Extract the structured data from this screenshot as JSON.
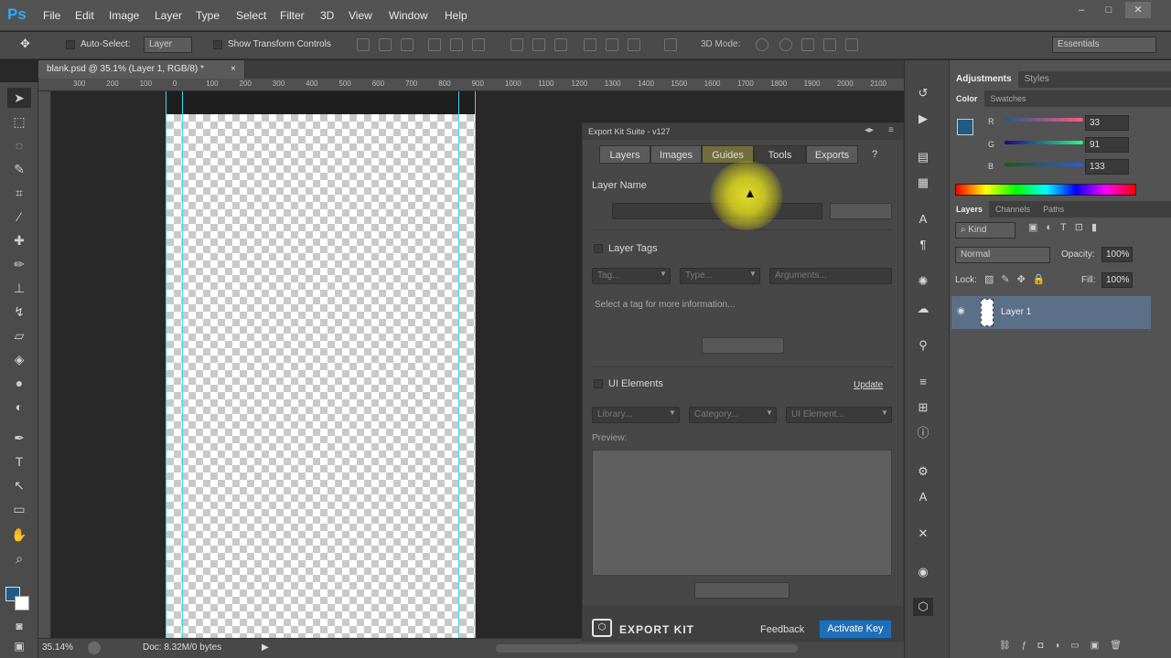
{
  "app": {
    "logo": "Ps"
  },
  "menu": [
    "File",
    "Edit",
    "Image",
    "Layer",
    "Type",
    "Select",
    "Filter",
    "3D",
    "View",
    "Window",
    "Help"
  ],
  "window_controls": {
    "min": "–",
    "max": "□",
    "close": "✕"
  },
  "options_bar": {
    "auto_select_label": "Auto-Select:",
    "auto_select_value": "Layer",
    "show_transform_label": "Show Transform Controls",
    "mode_3d_label": "3D Mode:",
    "workspace": "Essentials"
  },
  "document": {
    "tab_title": "blank.psd @ 35.1% (Layer 1, RGB/8) *",
    "tab_close": "×"
  },
  "ruler_labels": [
    "300",
    "200",
    "100",
    "0",
    "100",
    "200",
    "300",
    "400",
    "500",
    "600",
    "700",
    "800",
    "900",
    "1000",
    "1100",
    "1200",
    "1300",
    "1400",
    "1500",
    "1600",
    "1700",
    "1800",
    "1900",
    "2000",
    "2100",
    "2200"
  ],
  "status": {
    "zoom": "35.14%",
    "doc": "Doc: 8.32M/0 bytes"
  },
  "panels": {
    "adjustments_tabs": [
      "Adjustments",
      "Styles"
    ],
    "color_tabs": [
      "Color",
      "Swatches"
    ],
    "colors": {
      "fg": "#215b85",
      "r_label": "R",
      "g_label": "G",
      "b_label": "B",
      "r": "33",
      "g": "91",
      "b": "133"
    },
    "layers_tabs": [
      "Layers",
      "Channels",
      "Paths"
    ],
    "kind_label": "Kind",
    "blend_mode": "Normal",
    "opacity_label": "Opacity:",
    "opacity": "100%",
    "lock_label": "Lock:",
    "fill_label": "Fill:",
    "fill": "100%",
    "layer_name": "Layer 1"
  },
  "export_kit": {
    "title": "Export Kit Suite - v127",
    "tabs": [
      "Layers",
      "Images",
      "Guides",
      "Tools",
      "Exports"
    ],
    "help": "?",
    "layer_name_label": "Layer Name",
    "layer_tags_label": "Layer Tags",
    "tag_placeholder": "Tag...",
    "type_placeholder": "Type...",
    "arguments_placeholder": "Arguments...",
    "info_text": "Select a tag for more information...",
    "ui_elements_label": "UI Elements",
    "update_link": "Update",
    "library_placeholder": "Library...",
    "category_placeholder": "Category...",
    "ui_element_placeholder": "UI Element...",
    "preview_label": "Preview:",
    "brand": "EXPORT KIT",
    "feedback": "Feedback",
    "activate": "Activate Key"
  }
}
